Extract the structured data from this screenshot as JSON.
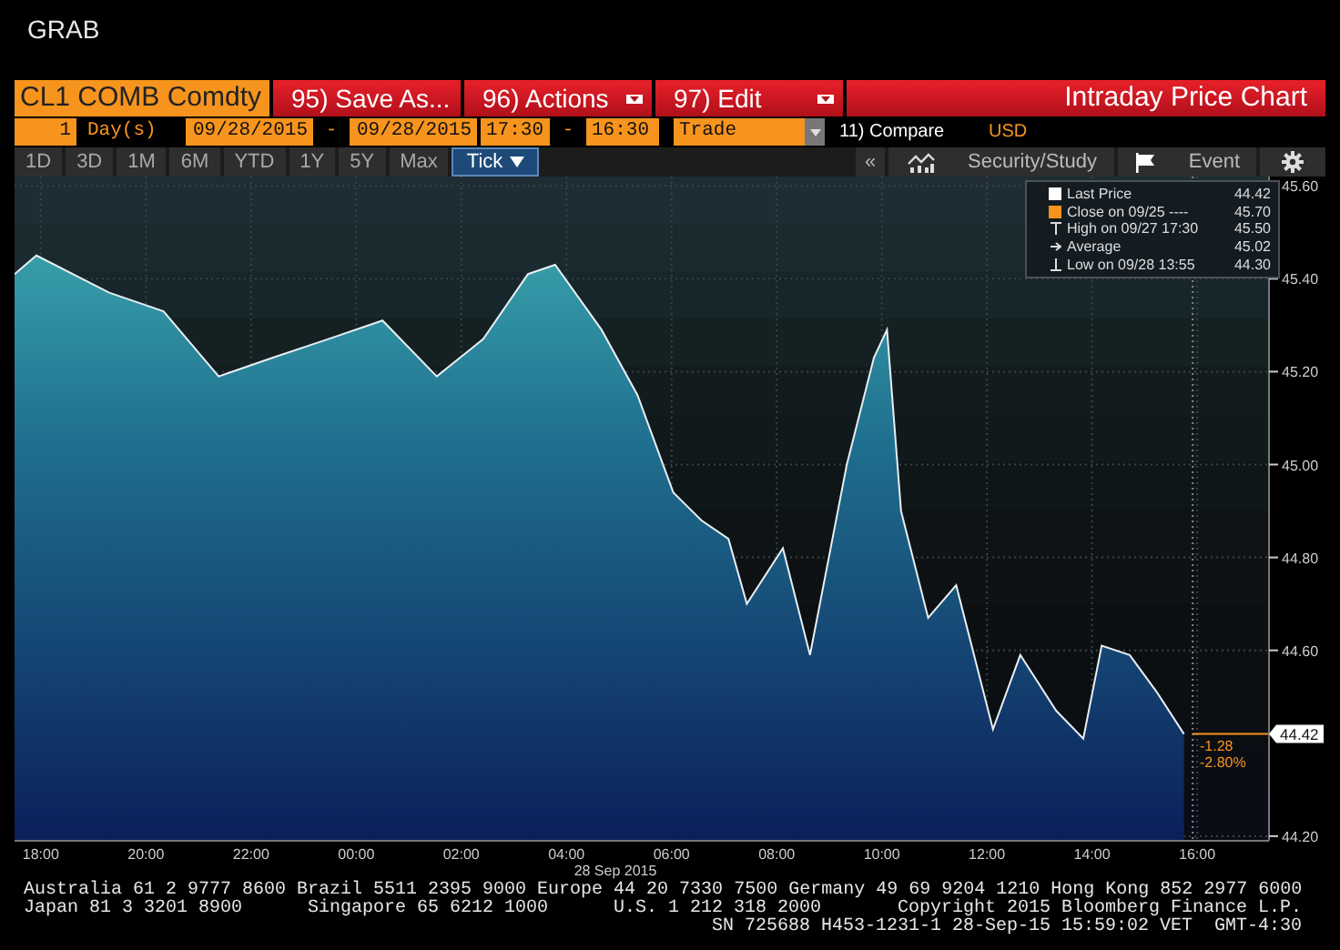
{
  "app_title": "GRAB",
  "security": {
    "value": "CL1 COMB Comdty"
  },
  "menu_buttons": [
    {
      "label": "95) Save As...",
      "dropdown": false
    },
    {
      "label": "96) Actions",
      "dropdown": true
    },
    {
      "label": "97) Edit",
      "dropdown": true
    }
  ],
  "window": {
    "title": "Intraday Price Chart"
  },
  "range": {
    "count": "1",
    "unit": "Day(s)",
    "start_date": "09/28/2015",
    "separator_1": "-",
    "end_date": "09/28/2015",
    "start_time": "17:30",
    "separator_2": "-",
    "end_time": "16:30",
    "event_type": "Trade",
    "compare": "11) Compare",
    "currency": "USD"
  },
  "periods": [
    {
      "label": "1D",
      "selected": false,
      "dropdown": false
    },
    {
      "label": "3D",
      "selected": false,
      "dropdown": false
    },
    {
      "label": "1M",
      "selected": false,
      "dropdown": false
    },
    {
      "label": "6M",
      "selected": false,
      "dropdown": false
    },
    {
      "label": "YTD",
      "selected": false,
      "dropdown": false
    },
    {
      "label": "1Y",
      "selected": false,
      "dropdown": false
    },
    {
      "label": "5Y",
      "selected": false,
      "dropdown": false
    },
    {
      "label": "Max",
      "selected": false,
      "dropdown": false
    },
    {
      "label": "Tick",
      "selected": true,
      "dropdown": true
    }
  ],
  "chart_tools": [
    {
      "kind": "collapse",
      "label": "«"
    },
    {
      "kind": "study",
      "label": "Security/Study"
    },
    {
      "kind": "event",
      "label": "Event"
    },
    {
      "kind": "settings"
    }
  ],
  "legend": [
    {
      "kind": "square",
      "color": "#ffffff",
      "label": "Last Price",
      "value": "44.42"
    },
    {
      "kind": "square",
      "color": "#f7941d",
      "label": "Close on 09/25 ----",
      "value": "45.70"
    },
    {
      "kind": "high",
      "label": "High on 09/27 17:30",
      "value": "45.50"
    },
    {
      "kind": "average",
      "label": "Average",
      "value": "45.02"
    },
    {
      "kind": "low",
      "label": "Low on 09/28 13:55",
      "value": "44.30"
    }
  ],
  "chart": {
    "chart_data": {
      "type": "area",
      "grid": true,
      "ref_lines": [
        {
          "axis": "x",
          "value": "2015-09-28 15:55"
        }
      ],
      "xlim": [
        "2015-09-27 17:30",
        "2015-09-28 17:22"
      ],
      "ylim": [
        44.19,
        45.62
      ],
      "xticks": [
        {
          "value": "2015-09-27 18:00",
          "label": "18:00"
        },
        {
          "value": "2015-09-27 20:00",
          "label": "20:00"
        },
        {
          "value": "2015-09-27 22:00",
          "label": "22:00"
        },
        {
          "value": "2015-09-28 00:00",
          "label": "00:00"
        },
        {
          "value": "2015-09-28 02:00",
          "label": "02:00"
        },
        {
          "value": "2015-09-28 04:00",
          "label": "04:00"
        },
        {
          "value": "2015-09-28 06:00",
          "label": "06:00"
        },
        {
          "value": "2015-09-28 08:00",
          "label": "08:00"
        },
        {
          "value": "2015-09-28 10:00",
          "label": "10:00"
        },
        {
          "value": "2015-09-28 12:00",
          "label": "12:00"
        },
        {
          "value": "2015-09-28 14:00",
          "label": "14:00"
        },
        {
          "value": "2015-09-28 16:00",
          "label": "16:00"
        }
      ],
      "yticks": [
        {
          "value": 45.6,
          "label": "45.60"
        },
        {
          "value": 45.4,
          "label": "45.40"
        },
        {
          "value": 45.2,
          "label": "45.20"
        },
        {
          "value": 45.0,
          "label": "45.00"
        },
        {
          "value": 44.8,
          "label": "44.80"
        },
        {
          "value": 44.6,
          "label": "44.60"
        },
        {
          "value": 44.2,
          "label": "44.20"
        }
      ],
      "x": [
        "2015-09-27 17:30",
        "2015-09-27 17:55",
        "2015-09-27 19:18",
        "2015-09-27 20:20",
        "2015-09-27 21:23",
        "2015-09-27 22:25",
        "2015-09-27 23:28",
        "2015-09-28 00:30",
        "2015-09-28 01:32",
        "2015-09-28 02:25",
        "2015-09-28 03:16",
        "2015-09-28 03:47",
        "2015-09-28 04:40",
        "2015-09-28 05:21",
        "2015-09-28 06:02",
        "2015-09-28 06:34",
        "2015-09-28 07:05",
        "2015-09-28 07:26",
        "2015-09-28 08:07",
        "2015-09-28 08:38",
        "2015-09-28 09:20",
        "2015-09-28 09:51",
        "2015-09-28 10:06",
        "2015-09-28 10:22",
        "2015-09-28 10:53",
        "2015-09-28 11:25",
        "2015-09-28 12:07",
        "2015-09-28 12:38",
        "2015-09-28 13:19",
        "2015-09-28 13:50",
        "2015-09-28 14:11",
        "2015-09-28 14:43",
        "2015-09-28 15:14",
        "2015-09-28 15:45"
      ],
      "series": [
        {
          "color": "#e8eef2",
          "values": [
            45.41,
            45.45,
            45.37,
            45.33,
            45.19,
            45.23,
            45.27,
            45.31,
            45.19,
            45.27,
            45.41,
            45.43,
            45.29,
            45.15,
            44.94,
            44.88,
            44.84,
            44.7,
            44.82,
            44.59,
            45.0,
            45.23,
            45.29,
            44.9,
            44.67,
            44.74,
            44.43,
            44.59,
            44.47,
            44.41,
            44.61,
            44.59,
            44.51,
            44.42
          ]
        }
      ]
    },
    "last_price": "44.42",
    "change": "-1.28",
    "change_percent": "-2.80%",
    "date_label": "28 Sep 2015"
  },
  "footer": {
    "line_1": "Australia 61 2 9777 8600 Brazil 5511 2395 9000 Europe 44 20 7330 7500 Germany 49 69 9204 1210 Hong Kong 852 2977 6000",
    "line_2": [
      "Japan 81 3 3201 8900",
      "Singapore 65 6212 1000",
      "U.S. 1 212 318 2000",
      "Copyright 2015 Bloomberg Finance L.P."
    ],
    "line_3": "SN 725688 H453-1231-1 28-Sep-15 15:59:02 VET  GMT-4:30"
  }
}
